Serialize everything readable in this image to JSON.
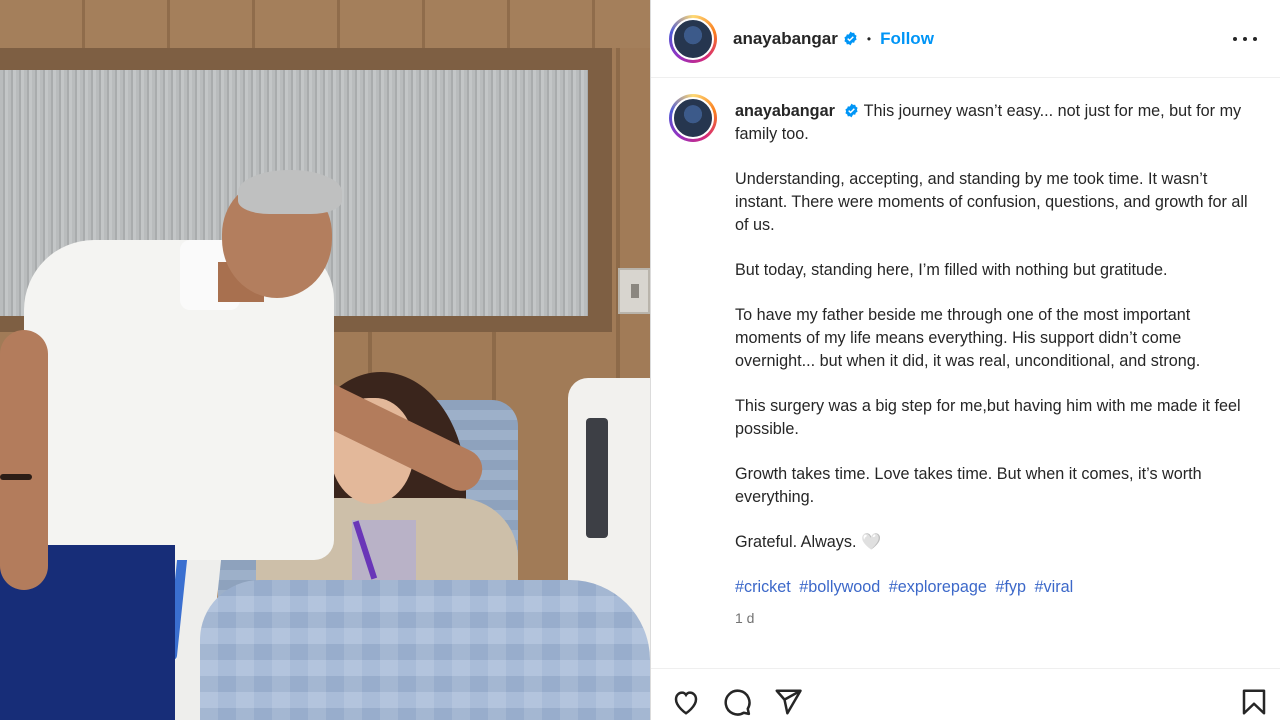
{
  "post": {
    "username": "anayabangar",
    "follow_label": "Follow",
    "separator": "•",
    "caption": {
      "username": "anayabangar",
      "first_line": "This journey wasn’t easy... not just for me, but for my family too.",
      "paragraphs": [
        "Understanding, accepting, and standing by me took time. It wasn’t instant. There were moments of confusion, questions, and growth for all of us.",
        "But today, standing here, I’m filled with nothing but gratitude.",
        "To have my father beside me through one of the most important moments of my life means everything. His support didn’t come overnight... but when it did, it was real, unconditional, and strong.",
        "This surgery was a big step for me,but having him with me made it feel possible.",
        "Growth takes time. Love takes time. But when it comes, it’s worth everything.",
        "Grateful. Always. 🤍"
      ],
      "hashtags": [
        "#cricket",
        "#bollywood",
        "#explorepage",
        "#fyp",
        "#viral"
      ]
    },
    "timestamp": "1 d"
  },
  "icons": {
    "verified": "verified-badge-icon",
    "more": "more-options-icon",
    "like": "heart-icon",
    "comment": "comment-icon",
    "share": "send-icon",
    "save": "bookmark-icon"
  },
  "colors": {
    "accent": "#0095f6",
    "hashtag": "#3c68c9",
    "text": "#262626",
    "muted": "#737373"
  }
}
